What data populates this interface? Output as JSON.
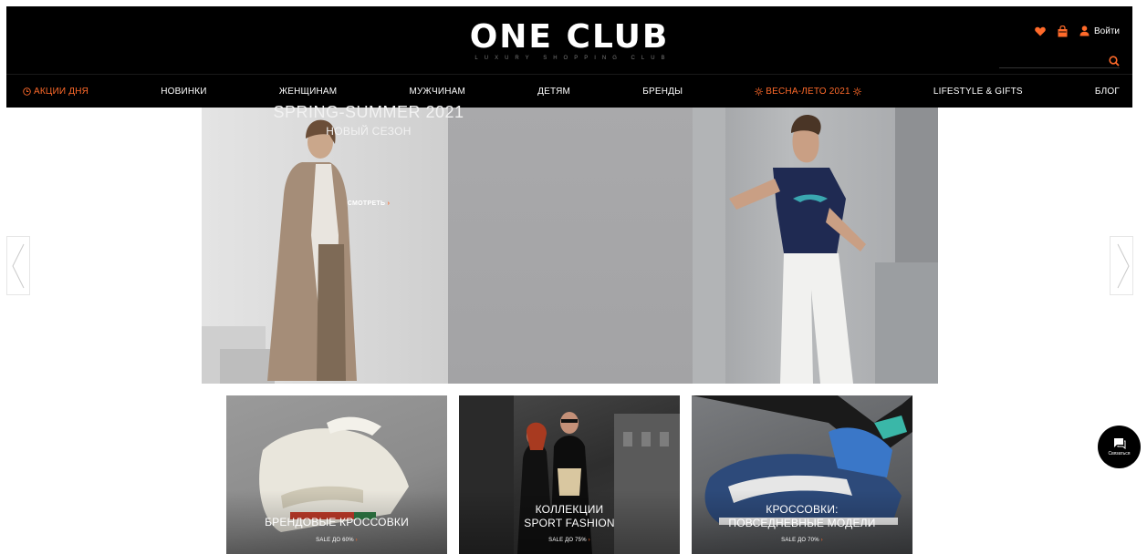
{
  "header": {
    "logo_main": "ONE CLUB",
    "logo_sub": "LUXURY SHOPPING CLUB",
    "login_label": "Войти",
    "icons": {
      "wishlist": "heart-icon",
      "cart": "bag-icon",
      "user": "user-icon",
      "search": "search-icon"
    }
  },
  "search": {
    "value": "",
    "placeholder": ""
  },
  "nav": {
    "items": [
      {
        "label": "Акции дня"
      },
      {
        "label": "Новинки"
      },
      {
        "label": "Женщинам"
      },
      {
        "label": "Мужчинам"
      },
      {
        "label": "Детям"
      },
      {
        "label": "Бренды"
      },
      {
        "label": "Весна-лето 2021"
      },
      {
        "label": "Lifestyle & gifts"
      },
      {
        "label": "Блог"
      }
    ]
  },
  "hero": {
    "title": "SPRING-SUMMER 2021",
    "subtitle": "НОВЫЙ СЕЗОН",
    "cta": "СМОТРЕТЬ"
  },
  "tiles": [
    {
      "line1": "БРЕНДОВЫЕ КРОССОВКИ",
      "line2": "",
      "sale": "SALE ДО 60%"
    },
    {
      "line1": "КОЛЛЕКЦИИ",
      "line2": "SPORT FASHION",
      "sale": "SALE ДО 75%"
    },
    {
      "line1": "КРОССОВКИ:",
      "line2": "ПОВСЕДНЕВНЫЕ МОДЕЛИ",
      "sale": "SALE ДО 70%"
    }
  ],
  "chat": {
    "label": "Связаться"
  },
  "colors": {
    "accent": "#ff6a2a",
    "header_bg": "#000000"
  }
}
